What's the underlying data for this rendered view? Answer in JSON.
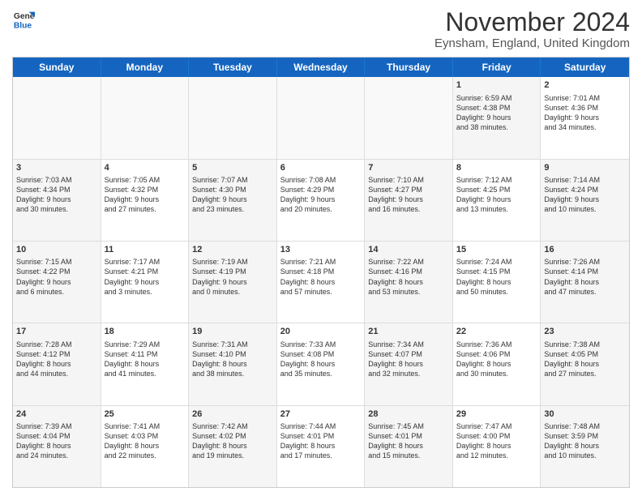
{
  "header": {
    "logo_general": "General",
    "logo_blue": "Blue",
    "month_title": "November 2024",
    "location": "Eynsham, England, United Kingdom"
  },
  "weekdays": [
    "Sunday",
    "Monday",
    "Tuesday",
    "Wednesday",
    "Thursday",
    "Friday",
    "Saturday"
  ],
  "rows": [
    [
      {
        "day": "",
        "text": "",
        "empty": true
      },
      {
        "day": "",
        "text": "",
        "empty": true
      },
      {
        "day": "",
        "text": "",
        "empty": true
      },
      {
        "day": "",
        "text": "",
        "empty": true
      },
      {
        "day": "",
        "text": "",
        "empty": true
      },
      {
        "day": "1",
        "text": "Sunrise: 6:59 AM\nSunset: 4:38 PM\nDaylight: 9 hours\nand 38 minutes.",
        "empty": false,
        "shaded": true
      },
      {
        "day": "2",
        "text": "Sunrise: 7:01 AM\nSunset: 4:36 PM\nDaylight: 9 hours\nand 34 minutes.",
        "empty": false,
        "shaded": false
      }
    ],
    [
      {
        "day": "3",
        "text": "Sunrise: 7:03 AM\nSunset: 4:34 PM\nDaylight: 9 hours\nand 30 minutes.",
        "empty": false,
        "shaded": true
      },
      {
        "day": "4",
        "text": "Sunrise: 7:05 AM\nSunset: 4:32 PM\nDaylight: 9 hours\nand 27 minutes.",
        "empty": false,
        "shaded": false
      },
      {
        "day": "5",
        "text": "Sunrise: 7:07 AM\nSunset: 4:30 PM\nDaylight: 9 hours\nand 23 minutes.",
        "empty": false,
        "shaded": true
      },
      {
        "day": "6",
        "text": "Sunrise: 7:08 AM\nSunset: 4:29 PM\nDaylight: 9 hours\nand 20 minutes.",
        "empty": false,
        "shaded": false
      },
      {
        "day": "7",
        "text": "Sunrise: 7:10 AM\nSunset: 4:27 PM\nDaylight: 9 hours\nand 16 minutes.",
        "empty": false,
        "shaded": true
      },
      {
        "day": "8",
        "text": "Sunrise: 7:12 AM\nSunset: 4:25 PM\nDaylight: 9 hours\nand 13 minutes.",
        "empty": false,
        "shaded": false
      },
      {
        "day": "9",
        "text": "Sunrise: 7:14 AM\nSunset: 4:24 PM\nDaylight: 9 hours\nand 10 minutes.",
        "empty": false,
        "shaded": true
      }
    ],
    [
      {
        "day": "10",
        "text": "Sunrise: 7:15 AM\nSunset: 4:22 PM\nDaylight: 9 hours\nand 6 minutes.",
        "empty": false,
        "shaded": true
      },
      {
        "day": "11",
        "text": "Sunrise: 7:17 AM\nSunset: 4:21 PM\nDaylight: 9 hours\nand 3 minutes.",
        "empty": false,
        "shaded": false
      },
      {
        "day": "12",
        "text": "Sunrise: 7:19 AM\nSunset: 4:19 PM\nDaylight: 9 hours\nand 0 minutes.",
        "empty": false,
        "shaded": true
      },
      {
        "day": "13",
        "text": "Sunrise: 7:21 AM\nSunset: 4:18 PM\nDaylight: 8 hours\nand 57 minutes.",
        "empty": false,
        "shaded": false
      },
      {
        "day": "14",
        "text": "Sunrise: 7:22 AM\nSunset: 4:16 PM\nDaylight: 8 hours\nand 53 minutes.",
        "empty": false,
        "shaded": true
      },
      {
        "day": "15",
        "text": "Sunrise: 7:24 AM\nSunset: 4:15 PM\nDaylight: 8 hours\nand 50 minutes.",
        "empty": false,
        "shaded": false
      },
      {
        "day": "16",
        "text": "Sunrise: 7:26 AM\nSunset: 4:14 PM\nDaylight: 8 hours\nand 47 minutes.",
        "empty": false,
        "shaded": true
      }
    ],
    [
      {
        "day": "17",
        "text": "Sunrise: 7:28 AM\nSunset: 4:12 PM\nDaylight: 8 hours\nand 44 minutes.",
        "empty": false,
        "shaded": true
      },
      {
        "day": "18",
        "text": "Sunrise: 7:29 AM\nSunset: 4:11 PM\nDaylight: 8 hours\nand 41 minutes.",
        "empty": false,
        "shaded": false
      },
      {
        "day": "19",
        "text": "Sunrise: 7:31 AM\nSunset: 4:10 PM\nDaylight: 8 hours\nand 38 minutes.",
        "empty": false,
        "shaded": true
      },
      {
        "day": "20",
        "text": "Sunrise: 7:33 AM\nSunset: 4:08 PM\nDaylight: 8 hours\nand 35 minutes.",
        "empty": false,
        "shaded": false
      },
      {
        "day": "21",
        "text": "Sunrise: 7:34 AM\nSunset: 4:07 PM\nDaylight: 8 hours\nand 32 minutes.",
        "empty": false,
        "shaded": true
      },
      {
        "day": "22",
        "text": "Sunrise: 7:36 AM\nSunset: 4:06 PM\nDaylight: 8 hours\nand 30 minutes.",
        "empty": false,
        "shaded": false
      },
      {
        "day": "23",
        "text": "Sunrise: 7:38 AM\nSunset: 4:05 PM\nDaylight: 8 hours\nand 27 minutes.",
        "empty": false,
        "shaded": true
      }
    ],
    [
      {
        "day": "24",
        "text": "Sunrise: 7:39 AM\nSunset: 4:04 PM\nDaylight: 8 hours\nand 24 minutes.",
        "empty": false,
        "shaded": true
      },
      {
        "day": "25",
        "text": "Sunrise: 7:41 AM\nSunset: 4:03 PM\nDaylight: 8 hours\nand 22 minutes.",
        "empty": false,
        "shaded": false
      },
      {
        "day": "26",
        "text": "Sunrise: 7:42 AM\nSunset: 4:02 PM\nDaylight: 8 hours\nand 19 minutes.",
        "empty": false,
        "shaded": true
      },
      {
        "day": "27",
        "text": "Sunrise: 7:44 AM\nSunset: 4:01 PM\nDaylight: 8 hours\nand 17 minutes.",
        "empty": false,
        "shaded": false
      },
      {
        "day": "28",
        "text": "Sunrise: 7:45 AM\nSunset: 4:01 PM\nDaylight: 8 hours\nand 15 minutes.",
        "empty": false,
        "shaded": true
      },
      {
        "day": "29",
        "text": "Sunrise: 7:47 AM\nSunset: 4:00 PM\nDaylight: 8 hours\nand 12 minutes.",
        "empty": false,
        "shaded": false
      },
      {
        "day": "30",
        "text": "Sunrise: 7:48 AM\nSunset: 3:59 PM\nDaylight: 8 hours\nand 10 minutes.",
        "empty": false,
        "shaded": true
      }
    ]
  ]
}
